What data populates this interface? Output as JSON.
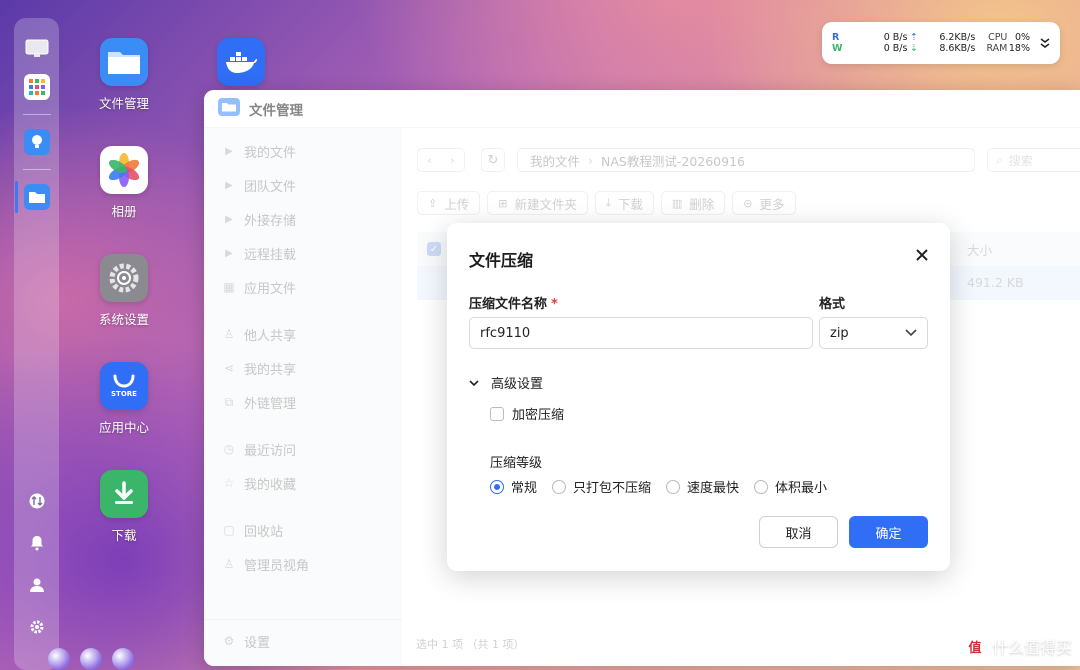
{
  "desktop": {
    "icons": [
      {
        "label": "文件管理"
      },
      {
        "label": "相册"
      },
      {
        "label": "系统设置"
      },
      {
        "label": "应用中心",
        "badge": "STORE"
      },
      {
        "label": "下载"
      }
    ]
  },
  "monitor": {
    "read_label": "R",
    "write_label": "W",
    "read_disk": "0  B/s",
    "write_disk": "0  B/s",
    "up_rate": "6.2KB/s",
    "down_rate": "8.6KB/s",
    "cpu_label": "CPU",
    "ram_label": "RAM",
    "cpu_value": "0%",
    "ram_value": "18%"
  },
  "window": {
    "title": "文件管理",
    "sidebar": {
      "items": [
        "我的文件",
        "团队文件",
        "外接存储",
        "远程挂载",
        "应用文件",
        "他人共享",
        "我的共享",
        "外链管理",
        "最近访问",
        "我的收藏",
        "回收站",
        "管理员视角"
      ],
      "settings": "设置"
    },
    "breadcrumb": {
      "root": "我的文件",
      "current": "NAS教程测试-20260916"
    },
    "search_placeholder": "搜索",
    "toolbar": {
      "upload": "上传",
      "new_folder": "新建文件夹",
      "download": "下载",
      "delete": "删除",
      "more": "更多"
    },
    "table": {
      "size_header": "大小",
      "row_size": "491.2 KB"
    },
    "status": "选中 1 项 （共 1 项）"
  },
  "dialog": {
    "title": "文件压缩",
    "name_label": "压缩文件名称",
    "required_mark": "*",
    "name_value": "rfc9110",
    "format_label": "格式",
    "format_value": "zip",
    "advanced_label": "高级设置",
    "encrypt_label": "加密压缩",
    "level_label": "压缩等级",
    "levels": [
      "常规",
      "只打包不压缩",
      "速度最快",
      "体积最小"
    ],
    "selected_level": "常规",
    "cancel": "取消",
    "confirm": "确定"
  },
  "watermark": {
    "logo": "值",
    "text": "什么值得买"
  },
  "colors": {
    "accent": "#2f6ef5",
    "required": "#e03b3b"
  }
}
